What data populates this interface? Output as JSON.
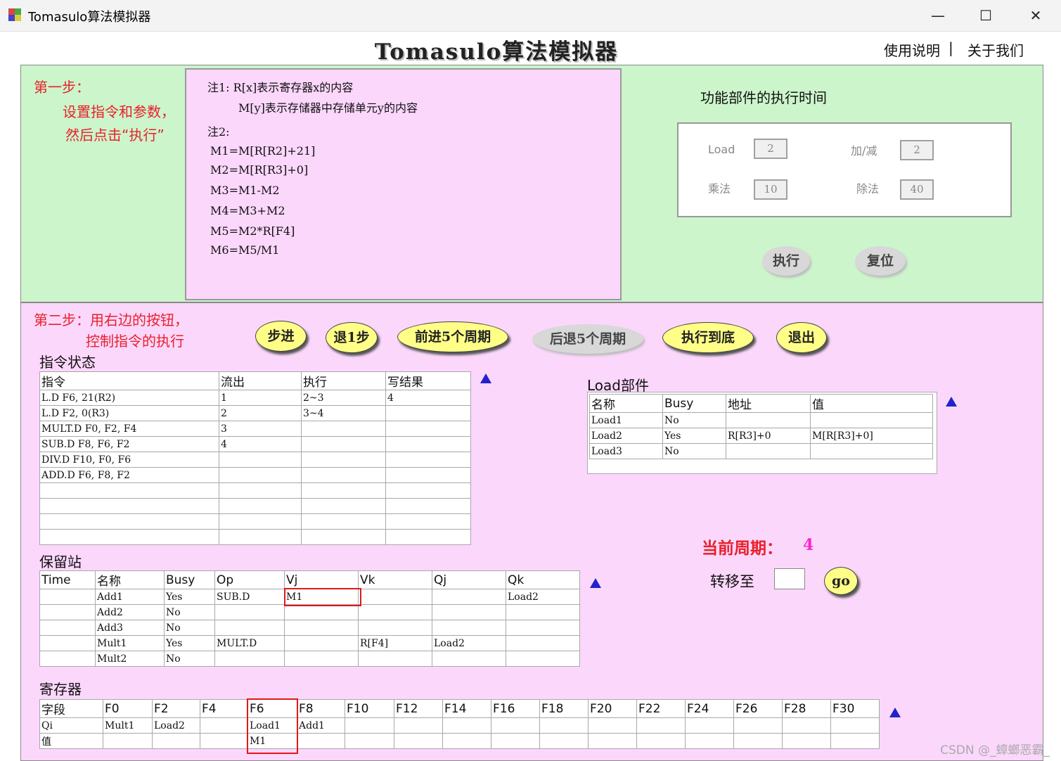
{
  "window": {
    "title": "Tomasulo算法模拟器",
    "minimize": "—",
    "maximize": "☐",
    "close": "✕"
  },
  "header": {
    "app_title": "Tomasulo算法模拟器",
    "link_help": "使用说明",
    "separator": "|",
    "link_about": "关于我们"
  },
  "step1": {
    "line1": "第一步：",
    "line2": "设置指令和参数，",
    "line3": "然后点击“执行”"
  },
  "notes": {
    "n1a": "注1: R[x]表示寄存器x的内容",
    "n1b": "M[y]表示存储器中存储单元y的内容",
    "n2": "注2:",
    "lines": [
      "M1=M[R[R2]+21]",
      "M2=M[R[R3]+0]",
      "M3=M1-M2",
      "M4=M3+M2",
      "M5=M2*R[F4]",
      "M6=M5/M1"
    ]
  },
  "func": {
    "title": "功能部件的执行时间",
    "load_label": "Load",
    "load_value": "2",
    "addsub_label": "加/减",
    "addsub_value": "2",
    "mul_label": "乘法",
    "mul_value": "10",
    "div_label": "除法",
    "div_value": "40",
    "exec_button": "执行",
    "reset_button": "复位"
  },
  "step2": {
    "line1": "第二步：用右边的按钮，",
    "line2": "控制指令的执行"
  },
  "controls": {
    "step": "步进",
    "back1": "退1步",
    "fwd5": "前进5个周期",
    "back5": "后退5个周期",
    "run_end": "执行到底",
    "exit": "退出"
  },
  "instr_status": {
    "title": "指令状态",
    "headers": [
      "指令",
      "流出",
      "执行",
      "写结果"
    ],
    "rows": [
      [
        "L.D     F6, 21(R2)",
        "1",
        "2~3",
        "4"
      ],
      [
        "L.D     F2, 0(R3)",
        "2",
        "3~4",
        ""
      ],
      [
        "MULT.D  F0, F2, F4",
        "3",
        "",
        ""
      ],
      [
        "SUB.D   F8, F6, F2",
        "4",
        "",
        ""
      ],
      [
        "DIV.D   F10, F0, F6",
        "",
        "",
        ""
      ],
      [
        "ADD.D   F6, F8, F2",
        "",
        "",
        ""
      ],
      [
        "",
        "",
        "",
        ""
      ],
      [
        "",
        "",
        "",
        ""
      ],
      [
        "",
        "",
        "",
        ""
      ],
      [
        "",
        "",
        "",
        ""
      ]
    ]
  },
  "load_unit": {
    "title": "Load部件",
    "headers": [
      "名称",
      "Busy",
      "地址",
      "值"
    ],
    "rows": [
      [
        "Load1",
        "No",
        "",
        ""
      ],
      [
        "Load2",
        "Yes",
        "R[R3]+0",
        "M[R[R3]+0]"
      ],
      [
        "Load3",
        "No",
        "",
        ""
      ]
    ]
  },
  "cycle": {
    "label": "当前周期：",
    "value": "4",
    "goto_label": "转移至",
    "go_button": "go"
  },
  "reservation": {
    "title": "保留站",
    "headers": [
      "Time",
      "名称",
      "Busy",
      "Op",
      "Vj",
      "Vk",
      "Qj",
      "Qk"
    ],
    "rows": [
      [
        "",
        "Add1",
        "Yes",
        "SUB.D",
        "M1",
        "",
        "",
        "Load2"
      ],
      [
        "",
        "Add2",
        "No",
        "",
        "",
        "",
        "",
        ""
      ],
      [
        "",
        "Add3",
        "No",
        "",
        "",
        "",
        "",
        ""
      ],
      [
        "",
        "Mult1",
        "Yes",
        "MULT.D",
        "",
        "R[F4]",
        "Load2",
        ""
      ],
      [
        "",
        "Mult2",
        "No",
        "",
        "",
        "",
        "",
        ""
      ]
    ]
  },
  "registers": {
    "title": "寄存器",
    "headers": [
      "字段",
      "F0",
      "F2",
      "F4",
      "F6",
      "F8",
      "F10",
      "F12",
      "F14",
      "F16",
      "F18",
      "F20",
      "F22",
      "F24",
      "F26",
      "F28",
      "F30"
    ],
    "qi": [
      "Qi",
      "Mult1",
      "Load2",
      "",
      "Load1",
      "Add1",
      "",
      "",
      "",
      "",
      "",
      "",
      "",
      "",
      "",
      "",
      ""
    ],
    "val": [
      "值",
      "",
      "",
      "",
      "M1",
      "",
      "",
      "",
      "",
      "",
      "",
      "",
      "",
      "",
      "",
      "",
      ""
    ]
  },
  "watermark": "CSDN @_蟑螂恶霸_",
  "colors": {
    "step_panel1": "#ccf5cc",
    "step_panel2": "#fcd7fc",
    "button_yellow": "#ffff88",
    "scroll_arrow": "#2222cc",
    "highlight_red": "#e01818",
    "cycle_value": "#ff22cc"
  }
}
